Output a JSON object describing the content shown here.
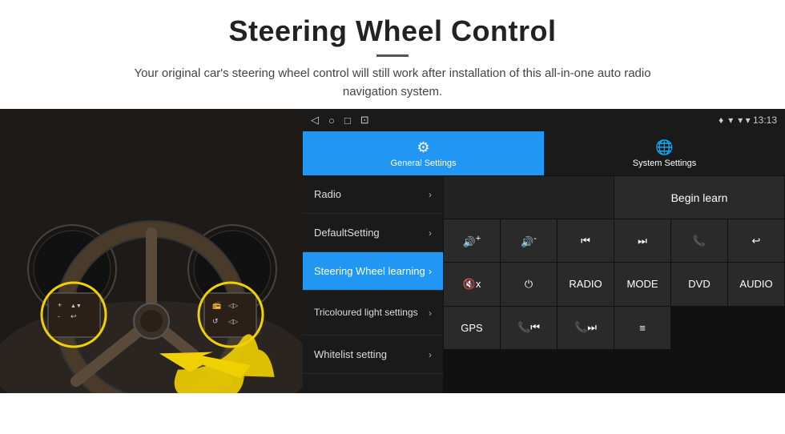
{
  "header": {
    "title": "Steering Wheel Control",
    "divider": true,
    "subtitle": "Your original car's steering wheel control will still work after installation of this all-in-one auto radio navigation system."
  },
  "statusBar": {
    "icons": [
      "◁",
      "○",
      "□",
      "⊡"
    ],
    "rightText": "▾ ▾  13:13"
  },
  "tabs": [
    {
      "id": "general",
      "icon": "⚙",
      "label": "General Settings",
      "active": true
    },
    {
      "id": "system",
      "icon": "🌐",
      "label": "System Settings",
      "active": false
    }
  ],
  "menuItems": [
    {
      "id": "radio",
      "label": "Radio",
      "active": false
    },
    {
      "id": "default",
      "label": "DefaultSetting",
      "active": false
    },
    {
      "id": "steering",
      "label": "Steering Wheel learning",
      "active": true
    },
    {
      "id": "tricoloured",
      "label": "Tricoloured light settings",
      "active": false
    },
    {
      "id": "whitelist",
      "label": "Whitelist setting",
      "active": false
    }
  ],
  "controls": {
    "beginLearn": "Begin learn",
    "buttons": [
      {
        "id": "vol-up",
        "icon": "🔊+",
        "text": ""
      },
      {
        "id": "vol-down",
        "icon": "🔊-",
        "text": ""
      },
      {
        "id": "prev-track",
        "icon": "⏮",
        "text": ""
      },
      {
        "id": "next-track",
        "icon": "⏭",
        "text": ""
      },
      {
        "id": "phone",
        "icon": "📞",
        "text": ""
      },
      {
        "id": "hang-up",
        "icon": "📵",
        "text": ""
      },
      {
        "id": "mute",
        "icon": "🔇",
        "text": "x"
      },
      {
        "id": "power",
        "icon": "⏻",
        "text": ""
      },
      {
        "id": "radio-btn",
        "text": "RADIO"
      },
      {
        "id": "mode-btn",
        "text": "MODE"
      },
      {
        "id": "dvd-btn",
        "text": "DVD"
      },
      {
        "id": "audio-btn",
        "text": "AUDIO"
      },
      {
        "id": "gps-btn",
        "text": "GPS"
      },
      {
        "id": "tel-prev",
        "icon": "📞⏮",
        "text": ""
      },
      {
        "id": "tel-next",
        "icon": "📞⏭",
        "text": ""
      },
      {
        "id": "playlist",
        "icon": "≡",
        "text": ""
      }
    ]
  }
}
